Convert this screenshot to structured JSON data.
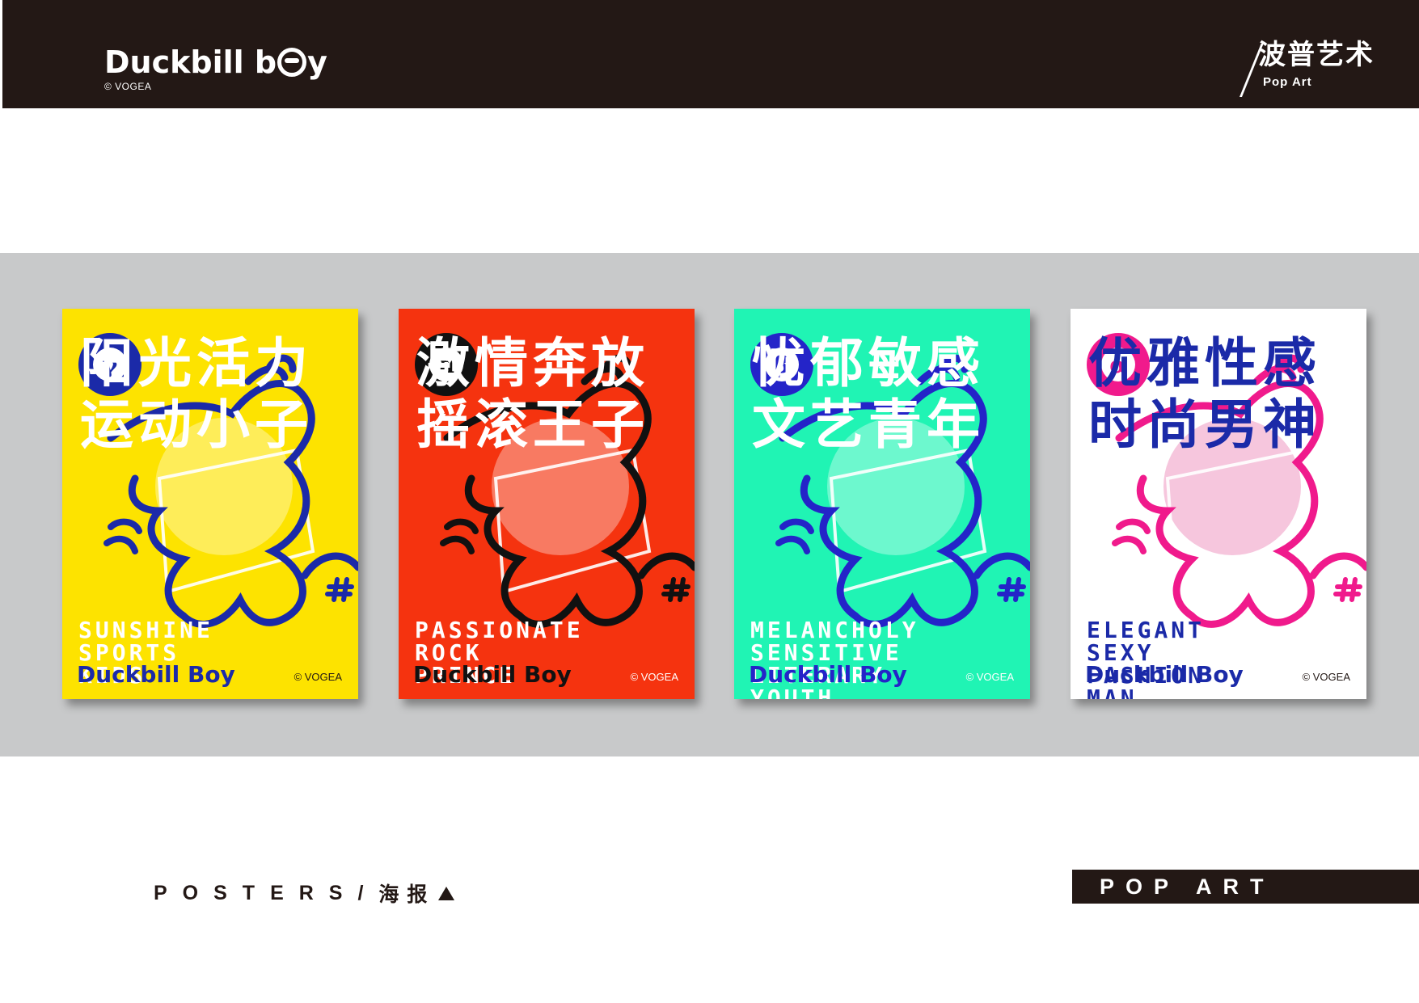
{
  "header": {
    "brand_name_part1": "Duckbill b",
    "brand_name_part2": "y",
    "brand_copyright": "© VOGEA",
    "category_zh": "波普艺术",
    "category_en": "Pop Art"
  },
  "posters": [
    {
      "background": "#fde300",
      "figure_color": "#1b2aa8",
      "zh_lines": [
        "阳光活力",
        "运动小子"
      ],
      "en_lines": [
        "SUNSHINE",
        "SPORTS",
        "KIDS"
      ],
      "brand": "Duckbill Boy",
      "brand_color": "#1b2aa8",
      "copyright": "© VOGEA",
      "badge_symbol": "γ",
      "badge_color": "#1b2aa8"
    },
    {
      "background": "#f5330f",
      "figure_color": "#111111",
      "zh_lines": [
        "激情奔放",
        "摇滚王子"
      ],
      "en_lines": [
        "PASSIONATE",
        "ROCK",
        "PRINCE"
      ],
      "brand": "Duckbill Boy",
      "brand_color": "#111111",
      "copyright": "© VOGEA",
      "badge_symbol": "π",
      "badge_color": "#111111"
    },
    {
      "background": "#20f4b4",
      "figure_color": "#2424c8",
      "zh_lines": [
        "忧郁敏感",
        "文艺青年"
      ],
      "en_lines": [
        "MELANCHOLY",
        "SENSITIVE",
        "LITERARY",
        "YOUTH"
      ],
      "brand": "Duckbill Boy",
      "brand_color": "#2424c8",
      "copyright": "© VOGEA",
      "badge_symbol": "β",
      "badge_color": "#2424c8"
    },
    {
      "background": "#ffffff",
      "figure_color": "#f01a8c",
      "zh_lines": [
        "优雅性感",
        "时尚男神"
      ],
      "en_lines": [
        "ELEGANT",
        "SEXY",
        "FASHION",
        "MAN"
      ],
      "brand": "Duckbill Boy",
      "brand_color": "#1b2aa8",
      "copyright": "© VOGEA",
      "badge_symbol": "α",
      "badge_color": "#f01a8c"
    }
  ],
  "footer": {
    "section_en": "POSTERS/",
    "section_zh": "海报",
    "tag": "POP ART"
  }
}
